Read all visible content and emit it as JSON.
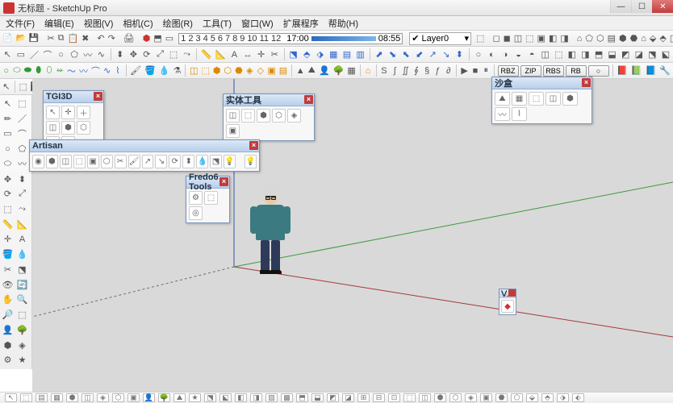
{
  "window": {
    "title": "无标题 - SketchUp Pro"
  },
  "winbuttons": {
    "min": "—",
    "max": "☐",
    "close": "✕"
  },
  "menu": [
    "文件(F)",
    "编辑(E)",
    "视图(V)",
    "相机(C)",
    "绘图(R)",
    "工具(T)",
    "窗口(W)",
    "扩展程序",
    "帮助(H)"
  ],
  "timeline": {
    "start_label": "17:00",
    "ticks": [
      "1",
      "2",
      "3",
      "4",
      "5",
      "6",
      "7",
      "8",
      "9",
      "10",
      "11",
      "12"
    ],
    "end_label": "08:55"
  },
  "layer": {
    "checked": true,
    "name": "Layer0"
  },
  "formats": [
    "RBZ",
    "ZIP",
    "RBS",
    "RB"
  ],
  "palettes": {
    "tgi": {
      "title": "TGI3D",
      "rows": 2,
      "cols": 4
    },
    "solid": {
      "title": "实体工具",
      "count": 6
    },
    "sandbox": {
      "title": "沙盒",
      "count": 7
    },
    "artisan": {
      "title": "Artisan",
      "count": 17
    },
    "fredo": {
      "title": "Fredo6 Tools",
      "count": 3
    },
    "vray": {
      "title": "V..."
    }
  },
  "toolbar_rows": {
    "r1": [
      "new",
      "open",
      "save",
      "sep",
      "cut",
      "copy",
      "paste",
      "del",
      "sep",
      "undo",
      "redo",
      "sep",
      "print",
      "sep",
      "model",
      "sep",
      "tl",
      "sep",
      "layer",
      "sep",
      "shapes7",
      "sep",
      "house5",
      "sep",
      "cube7",
      "sep",
      "red3"
    ],
    "r2": [
      "cursor",
      "rect",
      "line",
      "arc",
      "circ",
      "poly",
      "arc2",
      "arc3",
      "sep",
      "push",
      "move",
      "rot",
      "scale",
      "offset",
      "follow",
      "sep",
      "tape",
      "prot",
      "text",
      "dim",
      "axes",
      "sep",
      "sect",
      "sep",
      "iso",
      "top",
      "front",
      "right",
      "back",
      "left",
      "bottom",
      "sep",
      "orbit",
      "pan",
      "zoom",
      "zoome",
      "zoomw",
      "prev",
      "sep",
      "9more"
    ],
    "r3": [
      "shapes13",
      "sep",
      "edit6",
      "sep",
      "cube9",
      "sep",
      "walk5",
      "sep",
      "house",
      "sep",
      "curves7",
      "sep",
      "media3",
      "sep",
      "fmt",
      "sep",
      "docs4"
    ],
    "r4": [
      "sel3",
      "sep",
      "grid7",
      "sep",
      "comp7",
      "sep",
      "layers3",
      "sep",
      "paint3",
      "sep",
      "misc4",
      "sep",
      "style5",
      "sep",
      "sand9"
    ]
  }
}
